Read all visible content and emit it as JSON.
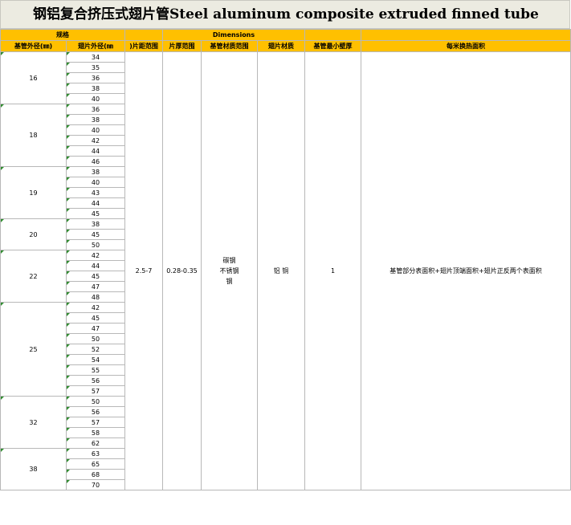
{
  "title": "钢铝复合挤压式翅片管Steel aluminum composite extruded finned tube",
  "headers": {
    "spec": "规格",
    "dimensions": "Dimensions",
    "base_od": "基管外径(㎜)",
    "fin_od": "翅片外径(㎜",
    "fin_pitch": ")片距范围",
    "fin_thickness": "片厚范围",
    "base_material": "基管材质范围",
    "fin_material": "翅片材质",
    "min_wall": "基管最小壁厚",
    "area": "每米换热面积"
  },
  "groups": [
    {
      "base": "16",
      "fins": [
        "34",
        "35",
        "36",
        "38",
        "40"
      ]
    },
    {
      "base": "18",
      "fins": [
        "36",
        "38",
        "40",
        "42",
        "44",
        "46"
      ]
    },
    {
      "base": "19",
      "fins": [
        "38",
        "40",
        "43",
        "44",
        "45"
      ]
    },
    {
      "base": "20",
      "fins": [
        "38",
        "45",
        "50"
      ]
    },
    {
      "base": "22",
      "fins": [
        "42",
        "44",
        "45",
        "47",
        "48"
      ]
    },
    {
      "base": "25",
      "fins": [
        "42",
        "45",
        "47",
        "50",
        "52",
        "54",
        "55",
        "56",
        "57"
      ]
    },
    {
      "base": "32",
      "fins": [
        "50",
        "56",
        "57",
        "58",
        "62"
      ]
    },
    {
      "base": "38",
      "fins": [
        "63",
        "65",
        "68",
        "70"
      ]
    }
  ],
  "specs": {
    "fin_pitch": "2.5-7",
    "fin_thickness": "0.28-0.35",
    "base_material_lines": [
      "碳钢",
      "不锈钢",
      "钢"
    ],
    "fin_material": "铝 铜",
    "min_wall": "1",
    "area": "基管部分表面积+翅片顶端面积+翅片正反两个表面积"
  }
}
